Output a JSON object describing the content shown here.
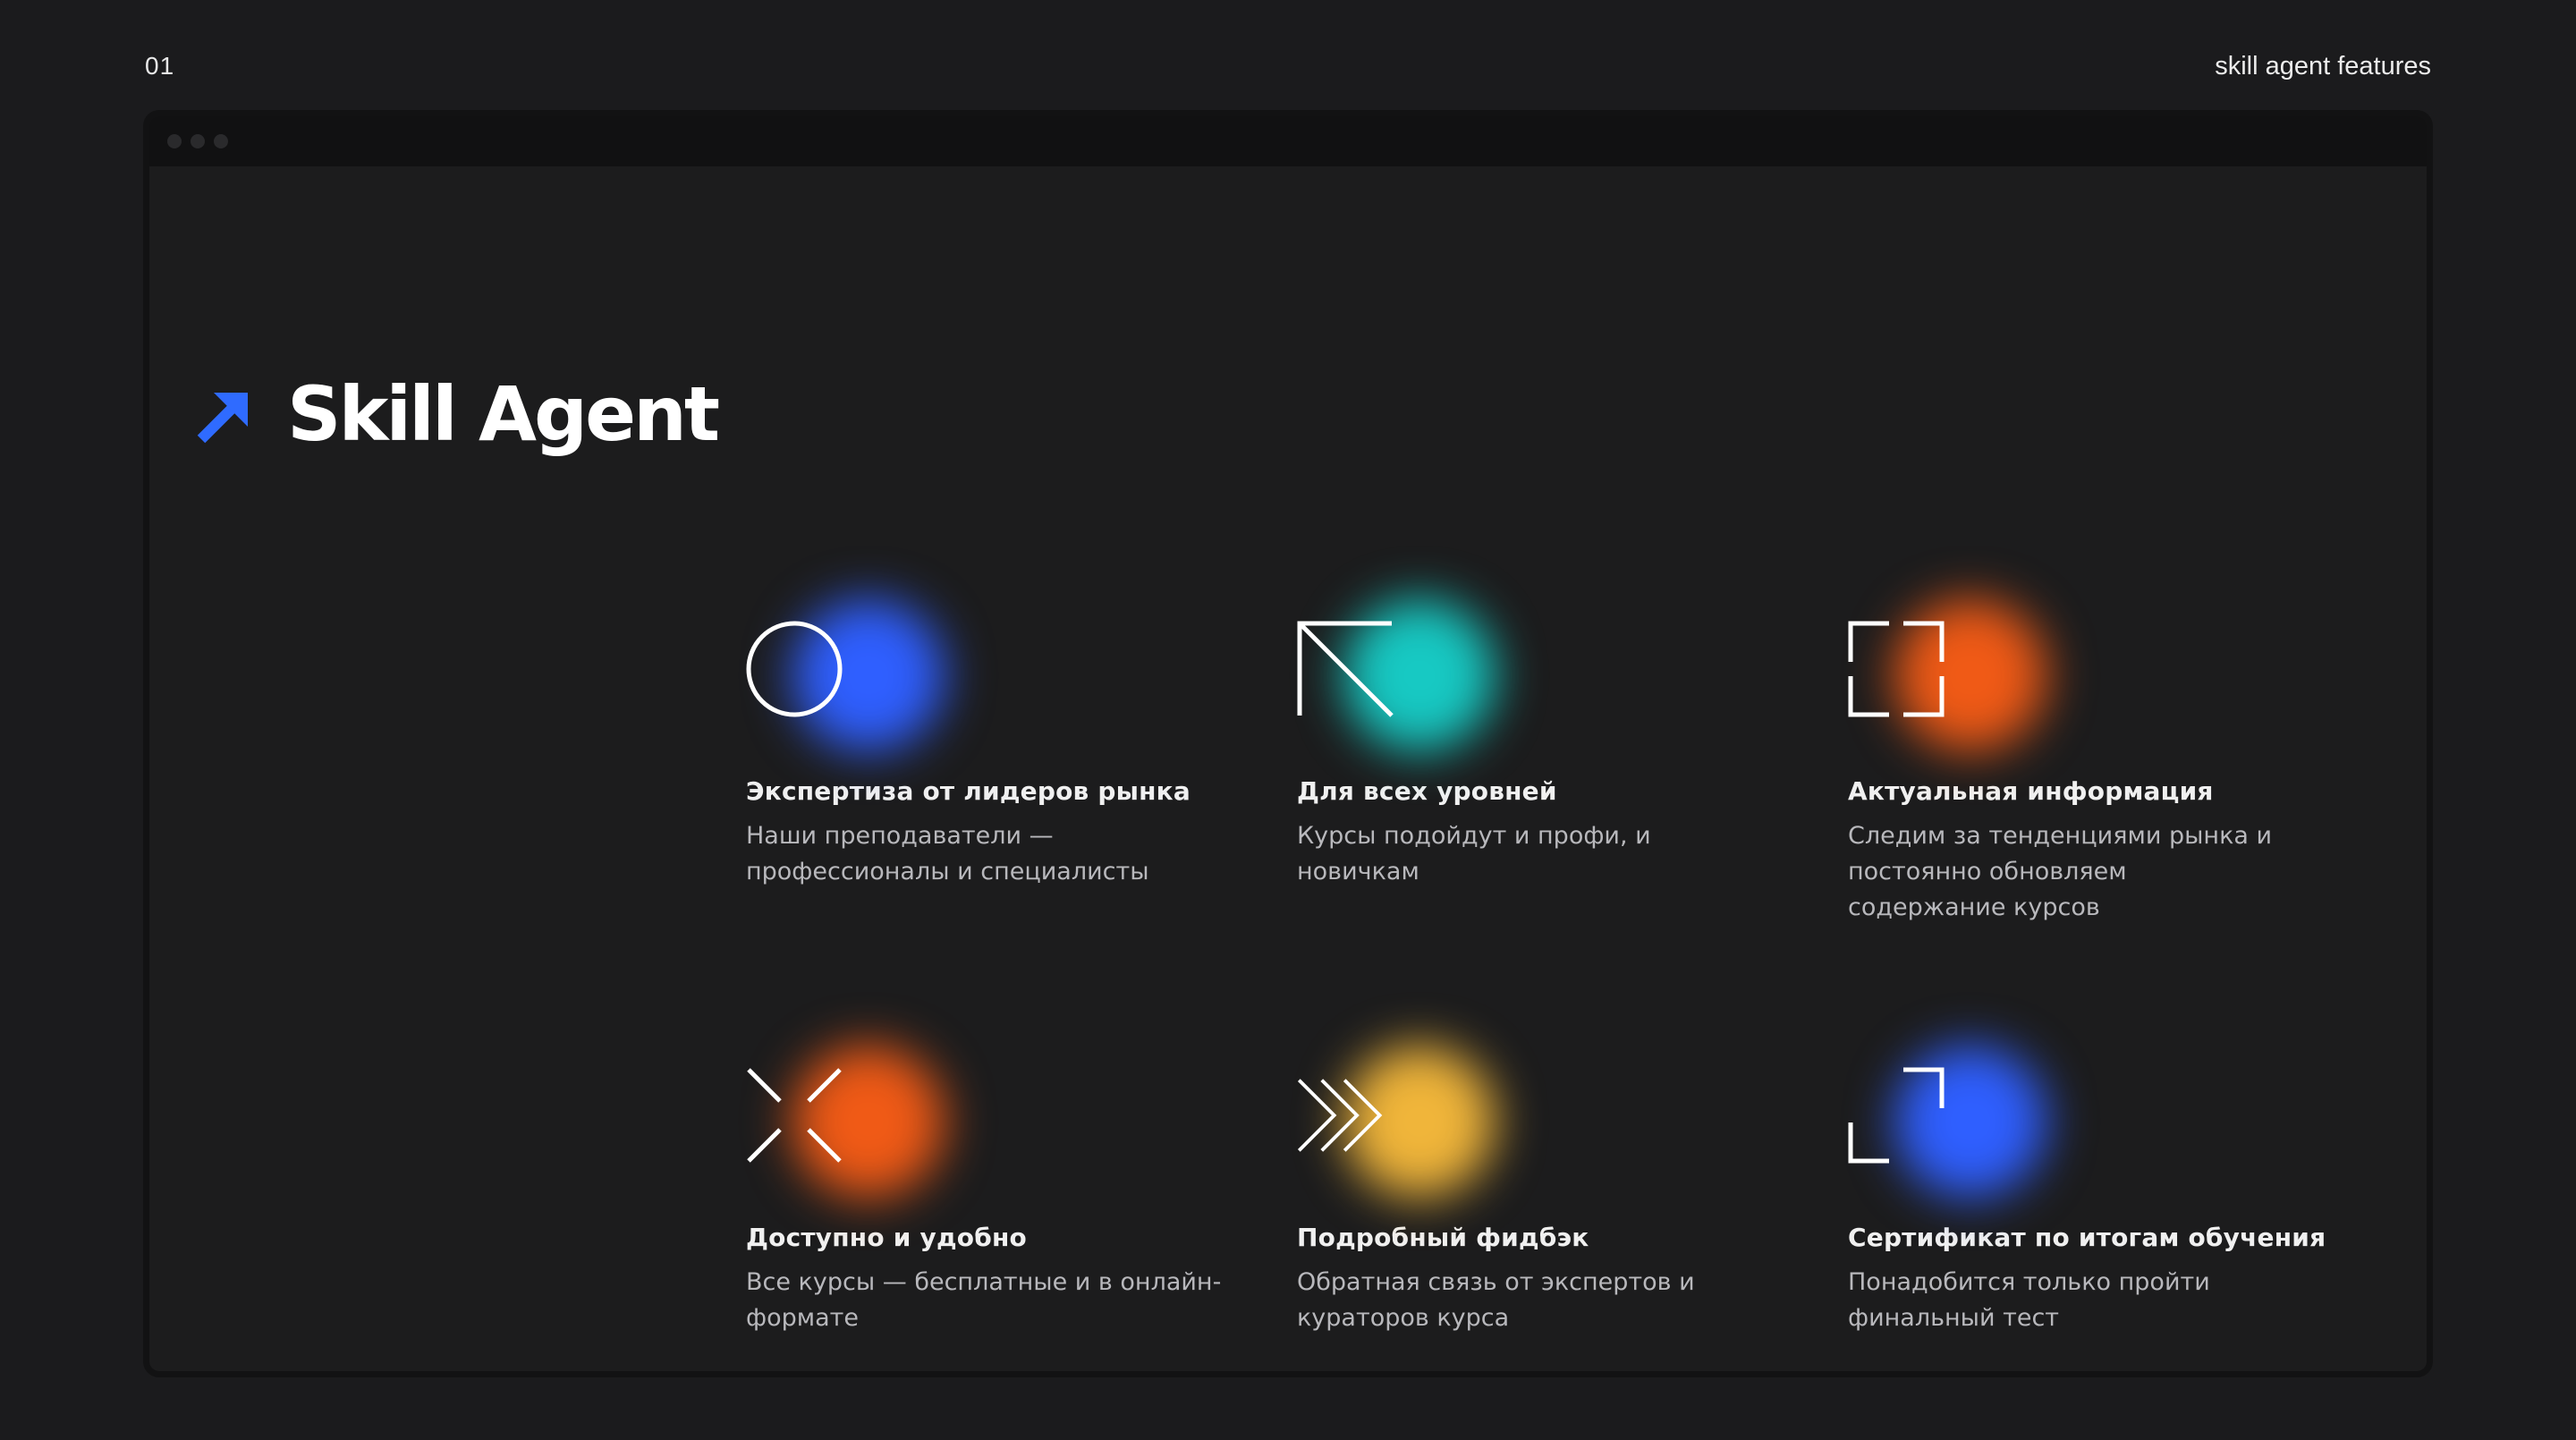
{
  "page": {
    "number": "01",
    "label": "skill agent features"
  },
  "brand": {
    "name": "Skill Agent",
    "accent_color": "#2f6bff",
    "icon": "arrow-up-right-icon"
  },
  "features": [
    {
      "title": "Экспертиза от лидеров рынка",
      "description": "Наши преподаватели — профессионалы и специалисты",
      "icon": "circle-icon",
      "glow_color": "#2f5fff"
    },
    {
      "title": "Для всех уровней",
      "description": "Курсы подойдут и профи, и новичкам",
      "icon": "arrow-up-left-icon",
      "glow_color": "#17c9c3"
    },
    {
      "title": "Актуальная информация",
      "description": "Следим за тенденциями рынка и постоянно обновляем содержание курсов",
      "icon": "frame-corners-icon",
      "glow_color": "#f05a16"
    },
    {
      "title": "Доступно и удобно",
      "description": "Все курсы — бесплатные и в онлайн-формате",
      "icon": "cross-icon",
      "glow_color": "#f05a16"
    },
    {
      "title": "Подробный фидбэк",
      "description": "Обратная связь от экспертов и кураторов курса",
      "icon": "triple-chevron-icon",
      "glow_color": "#f0b53a"
    },
    {
      "title": "Сертификат по итогам обучения",
      "description": "Понадобится только пройти финальный тест",
      "icon": "diagonal-corners-icon",
      "glow_color": "#2f5fff"
    }
  ]
}
